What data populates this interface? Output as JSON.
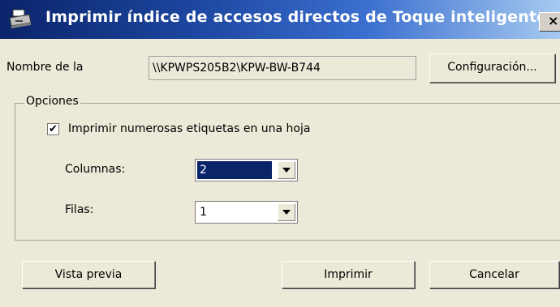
{
  "window": {
    "title": "Imprimir índice de accesos directos de Toque inteligente",
    "icon": "printer-icon",
    "close_label": "×"
  },
  "printer": {
    "label": "Nombre de la",
    "value": "\\\\KPWPS205B2\\KPW-BW-B744",
    "config_button": "Configuración..."
  },
  "options": {
    "group_label": "Opciones",
    "multi_labels": {
      "checked": true,
      "label": "Imprimir numerosas etiquetas en una hoja"
    },
    "columns": {
      "label": "Columnas:",
      "value": "2"
    },
    "rows": {
      "label": "Filas:",
      "value": "1"
    }
  },
  "footer": {
    "preview_button": "Vista previa",
    "print_button": "Imprimir",
    "cancel_button": "Cancelar"
  },
  "colors": {
    "title_gradient_start": "#0a246a",
    "title_gradient_end": "#a6caf0",
    "dialog_background": "#ece9d8",
    "selection": "#0a246a"
  }
}
